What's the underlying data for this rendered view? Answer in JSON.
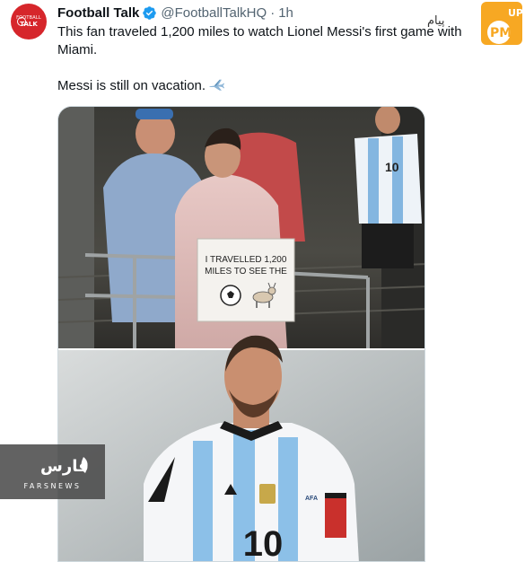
{
  "tweet": {
    "avatar_text_top": "FOOTBALL",
    "avatar_text_bottom": "TALK",
    "display_name": "Football Talk",
    "handle": "@FootballTalkHQ",
    "separator": "·",
    "time": "1h",
    "text_line1": "This fan traveled 1,200 miles to watch Lionel Messi's first game with",
    "text_line2": "Miami.",
    "text_line3": "Messi is still on vacation.",
    "icons": {
      "verified": "verified-badge-icon",
      "emoji": "airplane-emoji-icon"
    },
    "colors": {
      "verified": "#1d9bf0",
      "avatar": "#d6262b",
      "muted": "#536471"
    }
  },
  "media": {
    "sign_line1": "I TRAVELLED 1,200",
    "sign_line2": "MILES TO SEE THE",
    "shirt_number_top": "10",
    "shirt_number_bottom": "10",
    "badge_text": "AFA"
  },
  "watermarks": {
    "brand_text": "پیام",
    "pm_letters": "PM",
    "up_letters": "UP",
    "fars_persian": "فارس",
    "fars_latin": "FARSNEWS",
    "colors": {
      "pm": "#f7a823"
    }
  }
}
